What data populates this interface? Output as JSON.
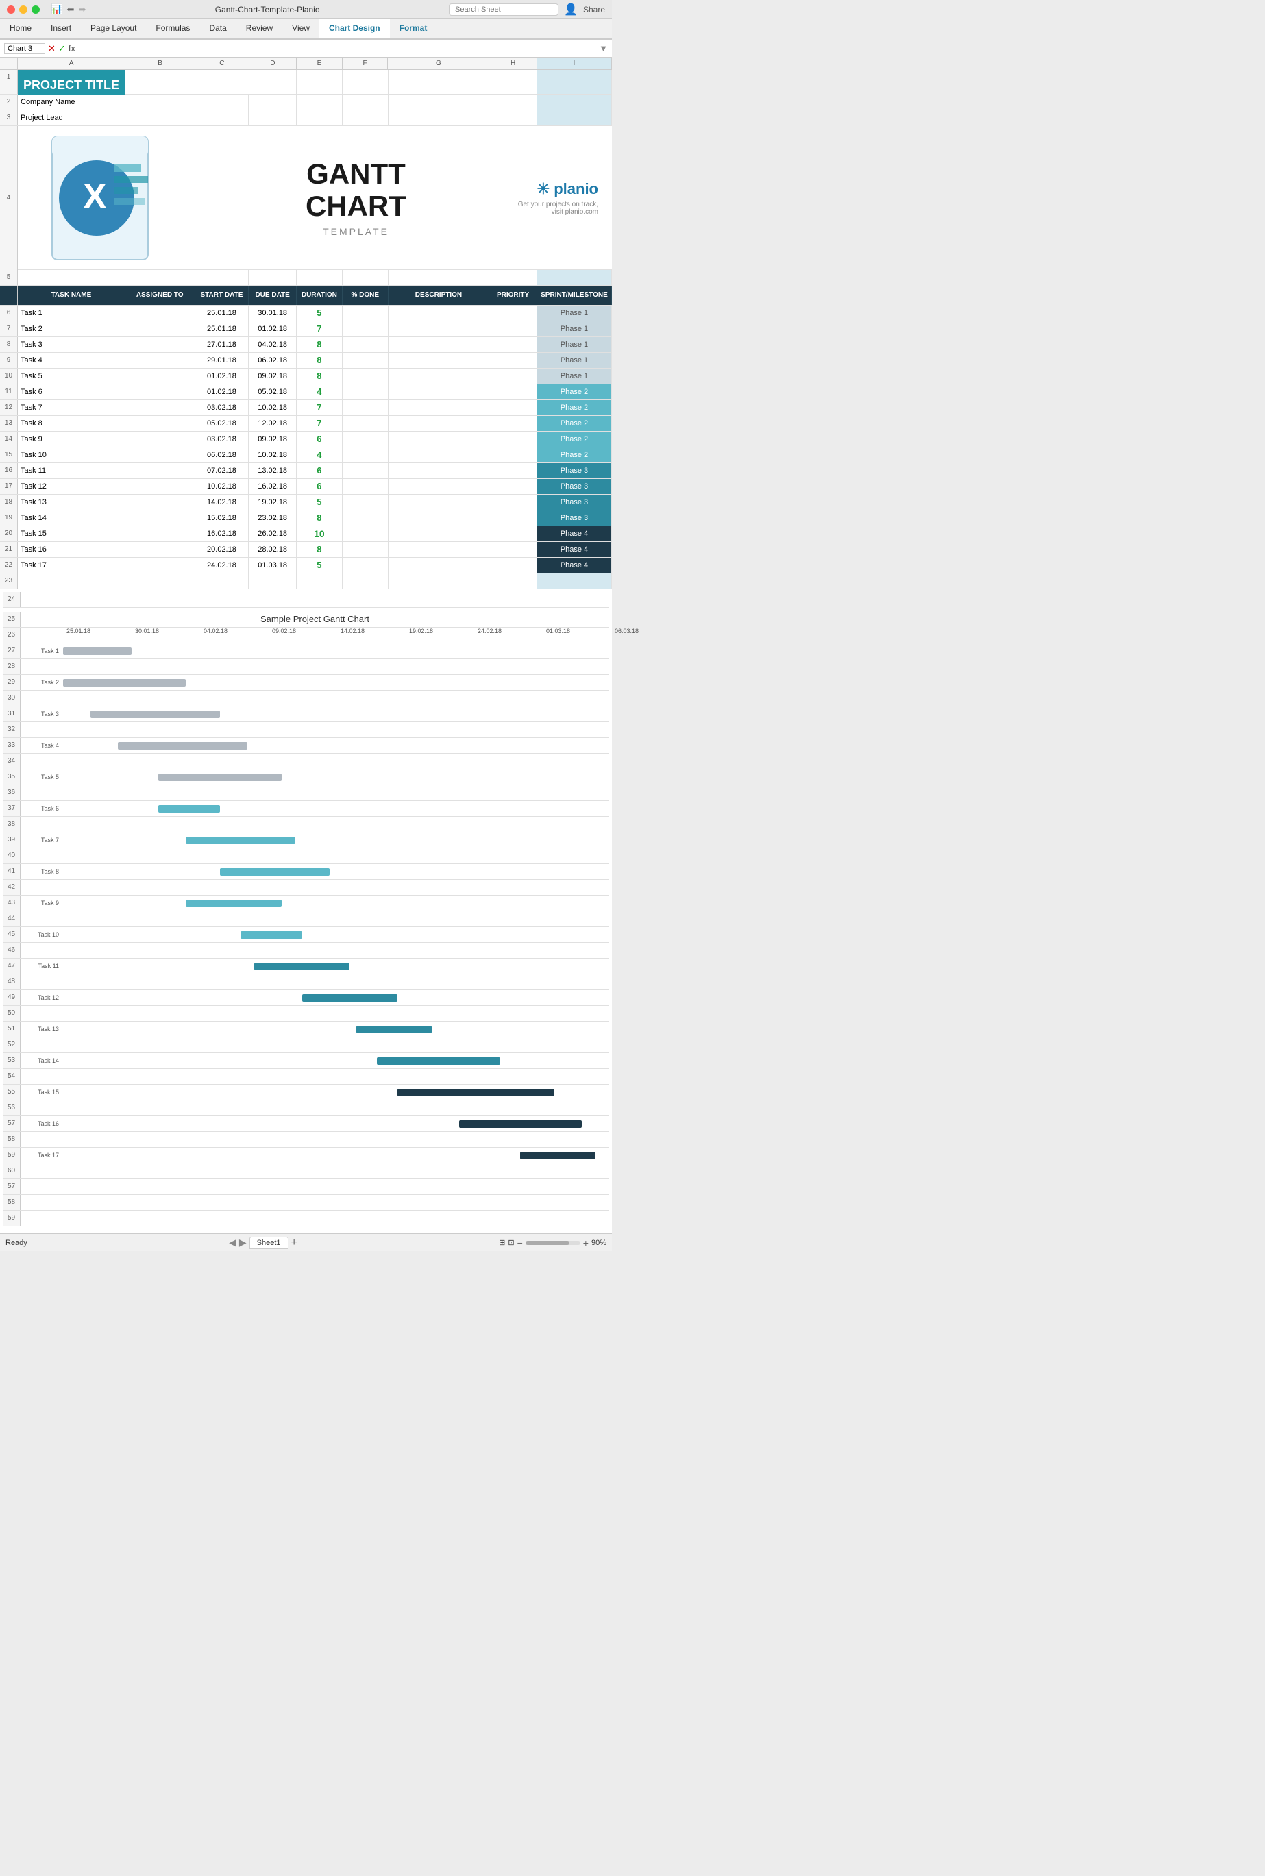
{
  "titleBar": {
    "title": "Gantt-Chart-Template-Planio",
    "search_placeholder": "Search Sheet"
  },
  "ribbon": {
    "tabs": [
      "Home",
      "Insert",
      "Page Layout",
      "Formulas",
      "Data",
      "Review",
      "View",
      "Chart Design",
      "Format"
    ],
    "active_tab": "Chart Design"
  },
  "formulaBar": {
    "cell_ref": "Chart 3",
    "formula": ""
  },
  "columns": [
    "A",
    "B",
    "C",
    "D",
    "E",
    "F",
    "G",
    "H",
    "I"
  ],
  "spreadsheet": {
    "project_title": "PROJECT TITLE",
    "company_name": "Company Name",
    "project_lead": "Project Lead",
    "table_headers": [
      "TASK NAME",
      "ASSIGNED TO",
      "START DATE",
      "DUE DATE",
      "DURATION",
      "% DONE",
      "DESCRIPTION",
      "PRIORITY",
      "SPRINT/MILESTONE"
    ],
    "tasks": [
      {
        "row": 6,
        "name": "Task 1",
        "assigned": "",
        "start": "25.01.18",
        "due": "30.01.18",
        "duration": "5",
        "done": "",
        "desc": "",
        "priority": "",
        "phase": "Phase 1",
        "phase_class": "phase1"
      },
      {
        "row": 7,
        "name": "Task 2",
        "assigned": "",
        "start": "25.01.18",
        "due": "01.02.18",
        "duration": "7",
        "done": "",
        "desc": "",
        "priority": "",
        "phase": "Phase 1",
        "phase_class": "phase1"
      },
      {
        "row": 8,
        "name": "Task 3",
        "assigned": "",
        "start": "27.01.18",
        "due": "04.02.18",
        "duration": "8",
        "done": "",
        "desc": "",
        "priority": "",
        "phase": "Phase 1",
        "phase_class": "phase1"
      },
      {
        "row": 9,
        "name": "Task 4",
        "assigned": "",
        "start": "29.01.18",
        "due": "06.02.18",
        "duration": "8",
        "done": "",
        "desc": "",
        "priority": "",
        "phase": "Phase 1",
        "phase_class": "phase1"
      },
      {
        "row": 10,
        "name": "Task 5",
        "assigned": "",
        "start": "01.02.18",
        "due": "09.02.18",
        "duration": "8",
        "done": "",
        "desc": "",
        "priority": "",
        "phase": "Phase 1",
        "phase_class": "phase1"
      },
      {
        "row": 11,
        "name": "Task 6",
        "assigned": "",
        "start": "01.02.18",
        "due": "05.02.18",
        "duration": "4",
        "done": "",
        "desc": "",
        "priority": "",
        "phase": "Phase 2",
        "phase_class": "phase2"
      },
      {
        "row": 12,
        "name": "Task 7",
        "assigned": "",
        "start": "03.02.18",
        "due": "10.02.18",
        "duration": "7",
        "done": "",
        "desc": "",
        "priority": "",
        "phase": "Phase 2",
        "phase_class": "phase2"
      },
      {
        "row": 13,
        "name": "Task 8",
        "assigned": "",
        "start": "05.02.18",
        "due": "12.02.18",
        "duration": "7",
        "done": "",
        "desc": "",
        "priority": "",
        "phase": "Phase 2",
        "phase_class": "phase2"
      },
      {
        "row": 14,
        "name": "Task 9",
        "assigned": "",
        "start": "03.02.18",
        "due": "09.02.18",
        "duration": "6",
        "done": "",
        "desc": "",
        "priority": "",
        "phase": "Phase 2",
        "phase_class": "phase2"
      },
      {
        "row": 15,
        "name": "Task 10",
        "assigned": "",
        "start": "06.02.18",
        "due": "10.02.18",
        "duration": "4",
        "done": "",
        "desc": "",
        "priority": "",
        "phase": "Phase 2",
        "phase_class": "phase2"
      },
      {
        "row": 16,
        "name": "Task 11",
        "assigned": "",
        "start": "07.02.18",
        "due": "13.02.18",
        "duration": "6",
        "done": "",
        "desc": "",
        "priority": "",
        "phase": "Phase 3",
        "phase_class": "phase3"
      },
      {
        "row": 17,
        "name": "Task 12",
        "assigned": "",
        "start": "10.02.18",
        "due": "16.02.18",
        "duration": "6",
        "done": "",
        "desc": "",
        "priority": "",
        "phase": "Phase 3",
        "phase_class": "phase3"
      },
      {
        "row": 18,
        "name": "Task 13",
        "assigned": "",
        "start": "14.02.18",
        "due": "19.02.18",
        "duration": "5",
        "done": "",
        "desc": "",
        "priority": "",
        "phase": "Phase 3",
        "phase_class": "phase3"
      },
      {
        "row": 19,
        "name": "Task 14",
        "assigned": "",
        "start": "15.02.18",
        "due": "23.02.18",
        "duration": "8",
        "done": "",
        "desc": "",
        "priority": "",
        "phase": "Phase 3",
        "phase_class": "phase3"
      },
      {
        "row": 20,
        "name": "Task 15",
        "assigned": "",
        "start": "16.02.18",
        "due": "26.02.18",
        "duration": "10",
        "done": "",
        "desc": "",
        "priority": "",
        "phase": "Phase 4",
        "phase_class": "phase4"
      },
      {
        "row": 21,
        "name": "Task 16",
        "assigned": "",
        "start": "20.02.18",
        "due": "28.02.18",
        "duration": "8",
        "done": "",
        "desc": "",
        "priority": "",
        "phase": "Phase 4",
        "phase_class": "phase4"
      },
      {
        "row": 22,
        "name": "Task 17",
        "assigned": "",
        "start": "24.02.18",
        "due": "01.03.18",
        "duration": "5",
        "done": "",
        "desc": "",
        "priority": "",
        "phase": "Phase 4",
        "phase_class": "phase4"
      }
    ]
  },
  "ganttChart": {
    "title": "Sample Project Gantt Chart",
    "dates": [
      "25.01.18",
      "30.01.18",
      "04.02.18",
      "09.02.18",
      "14.02.18",
      "19.02.18",
      "24.02.18",
      "01.03.18",
      "06.03.18"
    ],
    "tasks": [
      {
        "label": "Task 1",
        "start": 0,
        "width": 10,
        "color": "#b0b8c0"
      },
      {
        "label": "Task 2",
        "start": 0,
        "width": 18,
        "color": "#b0b8c0"
      },
      {
        "label": "Task 3",
        "start": 4,
        "width": 19,
        "color": "#b0b8c0"
      },
      {
        "label": "Task 4",
        "start": 8,
        "width": 19,
        "color": "#b0b8c0"
      },
      {
        "label": "Task 5",
        "start": 14,
        "width": 18,
        "color": "#b0b8c0"
      },
      {
        "label": "Task 6",
        "start": 14,
        "width": 9,
        "color": "#5bb8c8"
      },
      {
        "label": "Task 7",
        "start": 18,
        "width": 16,
        "color": "#5bb8c8"
      },
      {
        "label": "Task 8",
        "start": 23,
        "width": 16,
        "color": "#5bb8c8"
      },
      {
        "label": "Task 9",
        "start": 18,
        "width": 14,
        "color": "#5bb8c8"
      },
      {
        "label": "Task 10",
        "start": 26,
        "width": 9,
        "color": "#5bb8c8"
      },
      {
        "label": "Task 11",
        "start": 28,
        "width": 14,
        "color": "#2d8ba0"
      },
      {
        "label": "Task 12",
        "start": 35,
        "width": 14,
        "color": "#2d8ba0"
      },
      {
        "label": "Task 13",
        "start": 43,
        "width": 11,
        "color": "#2d8ba0"
      },
      {
        "label": "Task 14",
        "start": 46,
        "width": 18,
        "color": "#2d8ba0"
      },
      {
        "label": "Task 15",
        "start": 49,
        "width": 23,
        "color": "#1e3a4a"
      },
      {
        "label": "Task 16",
        "start": 58,
        "width": 18,
        "color": "#1e3a4a"
      },
      {
        "label": "Task 17",
        "start": 67,
        "width": 11,
        "color": "#1e3a4a"
      }
    ]
  },
  "bottomBar": {
    "status": "Ready",
    "sheet_name": "Sheet1",
    "zoom": "90%"
  },
  "colors": {
    "phase1": "#c8d8e0",
    "phase2": "#5bb8c8",
    "phase3": "#2d8ba0",
    "phase4": "#1e3a4a",
    "header_bg": "#1e3a4a",
    "project_title_bg": "#2196a7"
  }
}
